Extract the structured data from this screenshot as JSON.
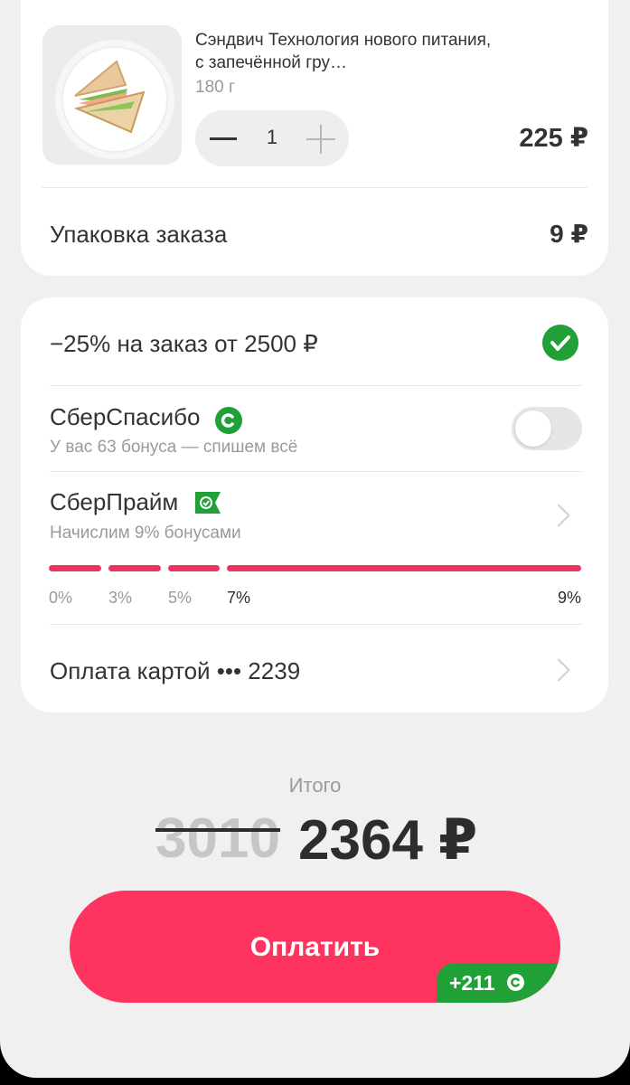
{
  "product": {
    "title": "Сэндвич Технология нового питания, с запечённой гру…",
    "weight": "180 г",
    "quantity": "1",
    "price": "225 ₽"
  },
  "packaging": {
    "label": "Упаковка заказа",
    "price": "9 ₽"
  },
  "promo": {
    "label": "−25% на заказ от 2500 ₽"
  },
  "sberspasibo": {
    "label": "СберСпасибо",
    "sublabel": "У вас 63 бонуса — спишем всё",
    "toggle_on": false
  },
  "sberprime": {
    "label": "СберПрайм",
    "sublabel": "Начислим 9% бонусами",
    "ticks": [
      "0%",
      "3%",
      "5%",
      "7%",
      "9%"
    ]
  },
  "payment": {
    "label": "Оплата картой ••• 2239"
  },
  "total": {
    "label": "Итого",
    "old_price": "3010",
    "new_price": "2364 ₽"
  },
  "pay_button": {
    "label": "Оплатить",
    "bonus": "+211"
  },
  "colors": {
    "accent": "#ff335f",
    "progress": "#f0325e",
    "sber_green": "#21a038"
  }
}
